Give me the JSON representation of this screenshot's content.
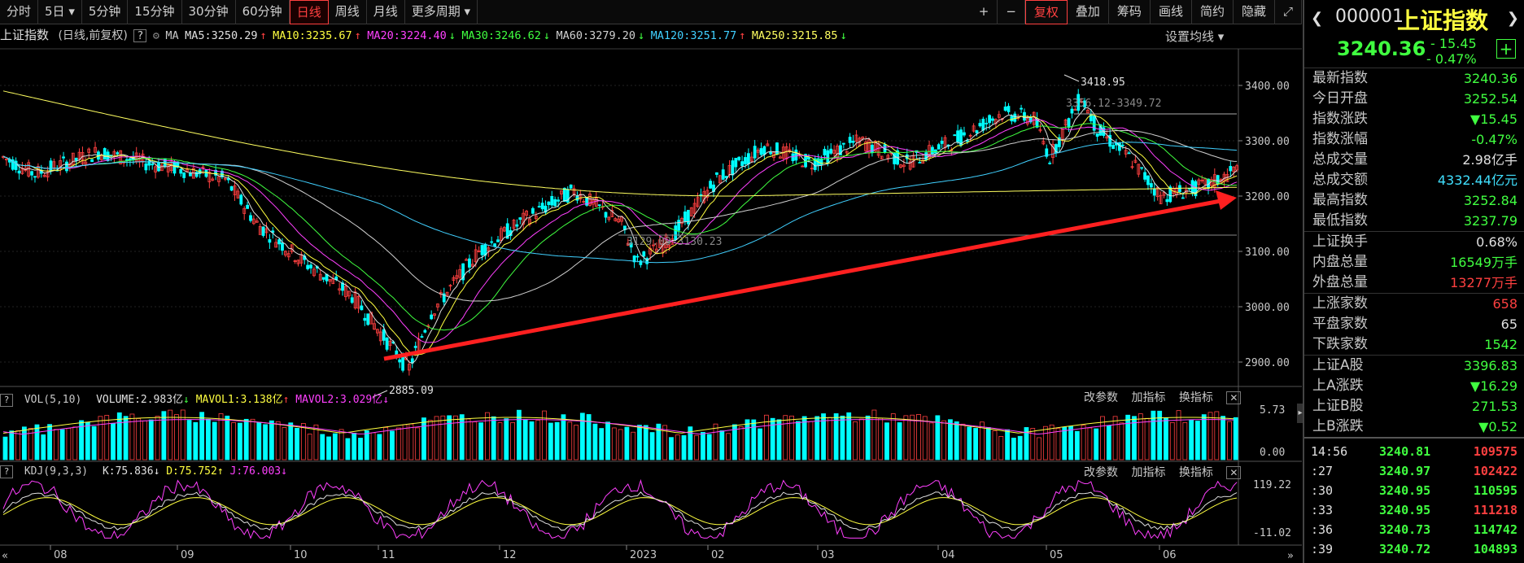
{
  "toolbar": {
    "periods": [
      "分时",
      "5日",
      "5分钟",
      "15分钟",
      "30分钟",
      "60分钟",
      "日线",
      "周线",
      "月线",
      "更多周期"
    ],
    "active_period": "日线",
    "right_buttons": [
      "+",
      "−",
      "复权",
      "叠加",
      "筹码",
      "画线",
      "简约",
      "隐藏"
    ]
  },
  "ma_bar": {
    "title": "上证指数",
    "mode": "(日线,前复权)",
    "ma_label": "MA",
    "ma5": "MA5:3250.29",
    "ma10": "MA10:3235.67",
    "ma20": "MA20:3224.40",
    "ma30": "MA30:3246.62",
    "ma60": "MA60:3279.20",
    "ma120": "MA120:3251.77",
    "ma250": "MA250:3215.85",
    "settings_label": "设置均线"
  },
  "colors": {
    "ma5": "#e0e0e0",
    "ma10": "#ffff40",
    "ma20": "#ff40ff",
    "ma30": "#40ff40",
    "ma60": "#d0d0d0",
    "ma120": "#40d0ff",
    "ma250": "#ffff60",
    "up": "#ff4040",
    "down": "#00ffff",
    "arrow": "#ff2020"
  },
  "price_axis": [
    "3400.00",
    "3300.00",
    "3200.00",
    "3100.00",
    "3000.00",
    "2900.00"
  ],
  "annotations": {
    "high": "3418.95",
    "range_top": "3356.12-3349.72",
    "range_mid": "3129.09-3130.23",
    "low": "2885.09"
  },
  "volume_panel": {
    "title": "VOL(5,10)",
    "volume": "VOLUME:2.983亿",
    "mavol1": "MAVOL1:3.138亿",
    "mavol2": "MAVOL2:3.029亿",
    "axis_top": "5.73",
    "axis_bottom": "0.00",
    "tools": [
      "改参数",
      "加指标",
      "换指标"
    ]
  },
  "kdj_panel": {
    "title": "KDJ(9,3,3)",
    "k": "K:75.836",
    "d": "D:75.752",
    "j": "J:76.003",
    "axis_top": "119.22",
    "axis_bottom": "-11.02",
    "tools": [
      "改参数",
      "加指标",
      "换指标"
    ]
  },
  "time_axis": [
    "08",
    "09",
    "10",
    "11",
    "12",
    "2023",
    "02",
    "03",
    "04",
    "05",
    "06"
  ],
  "quote": {
    "code": "000001",
    "name": "上证指数",
    "price": "3240.36",
    "change": "- 15.45",
    "change_pct": "- 0.47%",
    "rows": [
      {
        "label": "最新指数",
        "value": "3240.36",
        "cls": "g"
      },
      {
        "label": "今日开盘",
        "value": "3252.54",
        "cls": "g"
      },
      {
        "label": "指数涨跌",
        "value": "▼15.45",
        "cls": "g"
      },
      {
        "label": "指数涨幅",
        "value": "-0.47%",
        "cls": "g"
      },
      {
        "label": "总成交量",
        "value": "2.98亿手",
        "cls": "w"
      },
      {
        "label": "总成交额",
        "value": "4332.44亿元",
        "cls": "c"
      },
      {
        "label": "最高指数",
        "value": "3252.84",
        "cls": "g"
      },
      {
        "label": "最低指数",
        "value": "3237.79",
        "cls": "g"
      }
    ],
    "rows2": [
      {
        "label": "上证换手",
        "value": "0.68%",
        "cls": "w"
      },
      {
        "label": "内盘总量",
        "value": "16549万手",
        "cls": "g"
      },
      {
        "label": "外盘总量",
        "value": "13277万手",
        "cls": "r"
      }
    ],
    "rows3": [
      {
        "label": "上涨家数",
        "value": "658",
        "cls": "r"
      },
      {
        "label": "平盘家数",
        "value": "65",
        "cls": "w"
      },
      {
        "label": "下跌家数",
        "value": "1542",
        "cls": "g"
      }
    ],
    "rows4": [
      {
        "label": "上证A股",
        "value": "3396.83",
        "cls": "g"
      },
      {
        "label": "上A涨跌",
        "value": "▼16.29",
        "cls": "g"
      },
      {
        "label": "上证B股",
        "value": "271.53",
        "cls": "g"
      },
      {
        "label": "上B涨跌",
        "value": "▼0.52",
        "cls": "g"
      }
    ],
    "ticks": [
      {
        "time": "14:56",
        "price": "3240.81",
        "vol": "109575",
        "cls": "r"
      },
      {
        "time": ":27",
        "price": "3240.97",
        "vol": "102422",
        "cls": "r"
      },
      {
        "time": ":30",
        "price": "3240.95",
        "vol": "110595",
        "cls": "g"
      },
      {
        "time": ":33",
        "price": "3240.95",
        "vol": "111218",
        "cls": "r"
      },
      {
        "time": ":36",
        "price": "3240.73",
        "vol": "114742",
        "cls": "g"
      },
      {
        "time": ":39",
        "price": "3240.72",
        "vol": "104893",
        "cls": "g"
      }
    ]
  }
}
